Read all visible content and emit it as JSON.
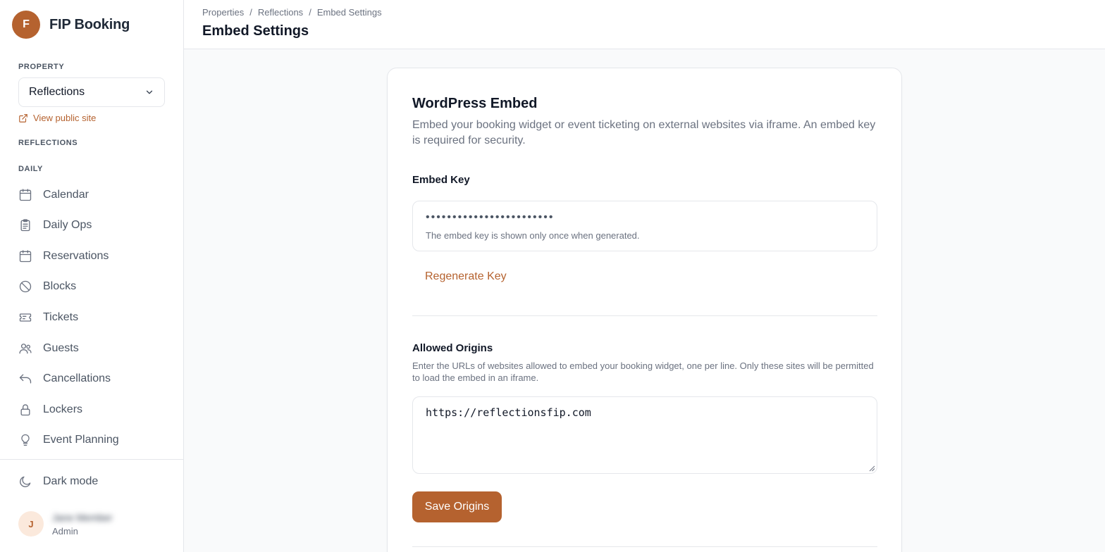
{
  "brand": {
    "initial": "F",
    "name": "FIP Booking"
  },
  "sidebar": {
    "property_label": "PROPERTY",
    "property_selected": "Reflections",
    "view_public_label": "View public site",
    "group_label": "REFLECTIONS",
    "section_label": "DAILY",
    "items": [
      {
        "label": "Calendar",
        "icon": "calendar-icon"
      },
      {
        "label": "Daily Ops",
        "icon": "clipboard-icon"
      },
      {
        "label": "Reservations",
        "icon": "calendar-icon"
      },
      {
        "label": "Blocks",
        "icon": "ban-icon"
      },
      {
        "label": "Tickets",
        "icon": "ticket-icon"
      },
      {
        "label": "Guests",
        "icon": "users-icon"
      },
      {
        "label": "Cancellations",
        "icon": "undo-icon"
      },
      {
        "label": "Lockers",
        "icon": "lock-icon"
      },
      {
        "label": "Event Planning",
        "icon": "lightbulb-icon"
      }
    ],
    "dark_mode_label": "Dark mode",
    "user": {
      "initial": "J",
      "name": "Jane Member",
      "role": "Admin"
    }
  },
  "header": {
    "breadcrumb": [
      "Properties",
      "Reflections",
      "Embed Settings"
    ],
    "title": "Embed Settings"
  },
  "card": {
    "title": "WordPress Embed",
    "description": "Embed your booking widget or event ticketing on external websites via iframe. An embed key is required for security.",
    "embed_key_label": "Embed Key",
    "embed_key_masked": "••••••••••••••••••••••••",
    "embed_key_hint": "The embed key is shown only once when generated.",
    "regenerate_label": "Regenerate Key",
    "origins_label": "Allowed Origins",
    "origins_description": "Enter the URLs of websites allowed to embed your booking widget, one per line. Only these sites will be permitted to load the embed in an iframe.",
    "origins_value": "https://reflectionsfip.com",
    "save_label": "Save Origins"
  },
  "colors": {
    "accent": "#b5622f",
    "accent_light": "#fbe9dc",
    "border": "#e5e7eb"
  }
}
